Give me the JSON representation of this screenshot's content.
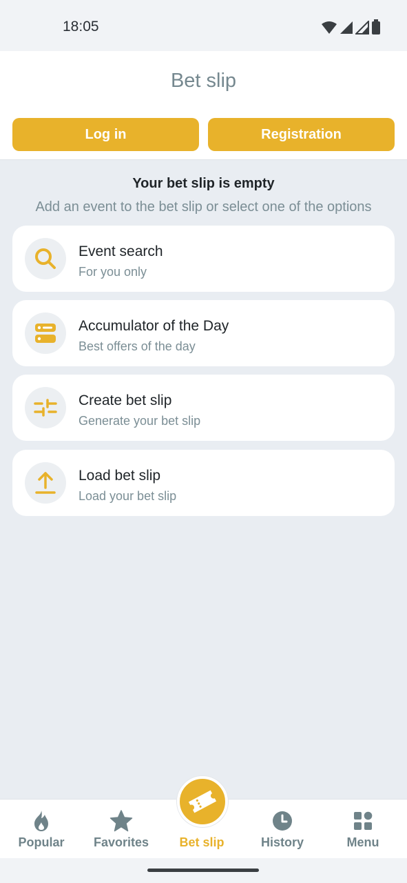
{
  "status_bar": {
    "time": "18:05",
    "icons": [
      "wifi-icon",
      "signal-icon",
      "signal-icon",
      "battery-icon"
    ]
  },
  "header": {
    "title": "Bet slip",
    "login_label": "Log in",
    "registration_label": "Registration"
  },
  "empty_state": {
    "title": "Your bet slip is empty",
    "subtitle": "Add an event to the bet slip or select one of the options"
  },
  "options": [
    {
      "icon": "search-icon",
      "title": "Event search",
      "subtitle": "For you only"
    },
    {
      "icon": "accumulator-icon",
      "title": "Accumulator of the Day",
      "subtitle": "Best offers of the day"
    },
    {
      "icon": "sliders-icon",
      "title": "Create bet slip",
      "subtitle": "Generate your bet slip"
    },
    {
      "icon": "upload-icon",
      "title": "Load bet slip",
      "subtitle": "Load your bet slip"
    }
  ],
  "bottom_nav": {
    "items": [
      {
        "label": "Popular",
        "icon": "flame-icon",
        "active": false
      },
      {
        "label": "Favorites",
        "icon": "star-icon",
        "active": false
      },
      {
        "label": "Bet slip",
        "icon": "ticket-icon",
        "active": true
      },
      {
        "label": "History",
        "icon": "clock-icon",
        "active": false
      },
      {
        "label": "Menu",
        "icon": "grid-icon",
        "active": false
      }
    ]
  },
  "colors": {
    "accent": "#e8b22b",
    "muted_text": "#7b8e95",
    "background": "#e9edf2"
  }
}
